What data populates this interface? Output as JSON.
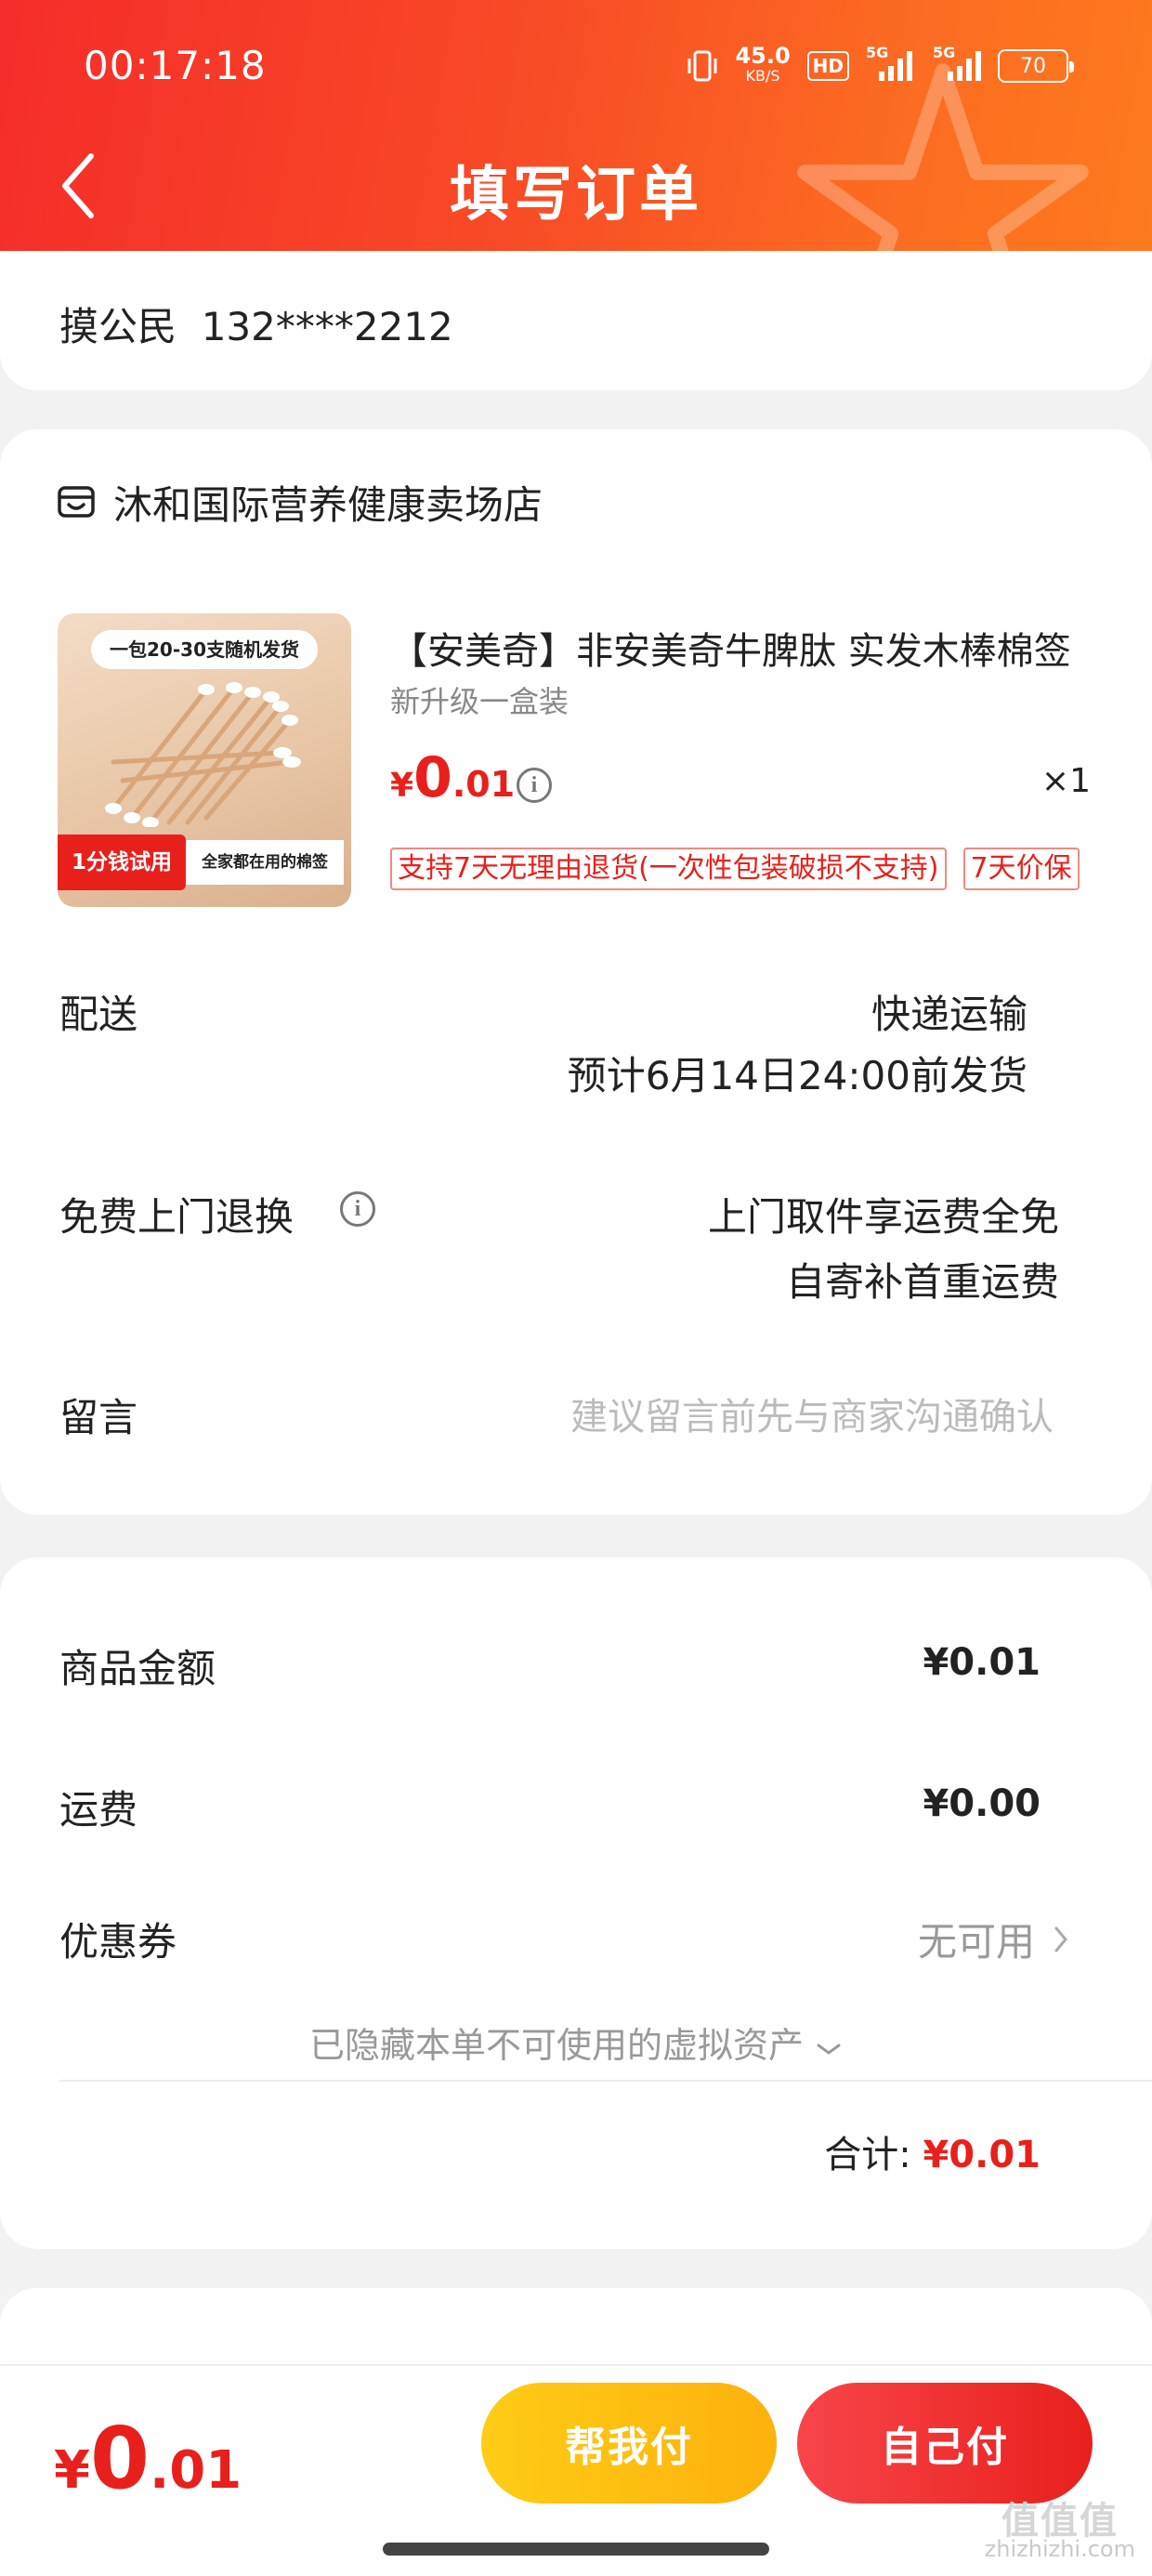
{
  "status_bar": {
    "time": "00:17:18",
    "net_speed": "45.0",
    "net_unit": "KB/S",
    "hd_label": "HD",
    "signal1": "5G",
    "signal2": "5G",
    "battery": "70"
  },
  "header": {
    "title": "填写订单",
    "back_icon": "chevron-left-icon"
  },
  "address": {
    "recipient": "摸公民  132****2212"
  },
  "order": {
    "store_name": "沐和国际营养健康卖场店",
    "store_icon": "store-icon",
    "product": {
      "thumb_top_tag": "一包20-30支随机发货",
      "thumb_red_tag": "1分钱试用",
      "thumb_white_tag": "全家都在用的棉签",
      "title": "【安美奇】非安美奇牛脾肽 实发木棒棉签",
      "spec": "新升级一盒装",
      "price_currency": "¥",
      "price_int": "0",
      "price_dec": ".01",
      "quantity": "×1",
      "tags": [
        "支持7天无理由退货(一次性包装破损不支持)",
        "7天价保"
      ]
    },
    "delivery": {
      "label": "配送",
      "method": "快递运输",
      "eta": "预计6月14日24:00前发货"
    },
    "return_service": {
      "label": "免费上门退换",
      "line1": "上门取件享运费全免",
      "line2": "自寄补首重运费"
    },
    "message": {
      "label": "留言",
      "placeholder": "建议留言前先与商家沟通确认"
    }
  },
  "summary": {
    "goods_label": "商品金额",
    "goods_amount": "¥0.01",
    "shipping_label": "运费",
    "shipping_amount": "¥0.00",
    "coupon_label": "优惠券",
    "coupon_value": "无可用",
    "hidden_assets_note": "已隐藏本单不可使用的虚拟资产",
    "total_label": "合计:",
    "total_value": "¥0.01"
  },
  "bottom_bar": {
    "price_currency": "¥",
    "price_int": "0",
    "price_dec": ".01",
    "help_pay_label": "帮我付",
    "self_pay_label": "自己付"
  },
  "watermark": {
    "logo_text": "值值值",
    "url": "zhizhizhi.com"
  },
  "colors": {
    "accent_red": "#e8201c",
    "header_start": "#f52c2a",
    "header_end": "#fd7a1e",
    "help_pay_yellow": "#fdb10c"
  }
}
